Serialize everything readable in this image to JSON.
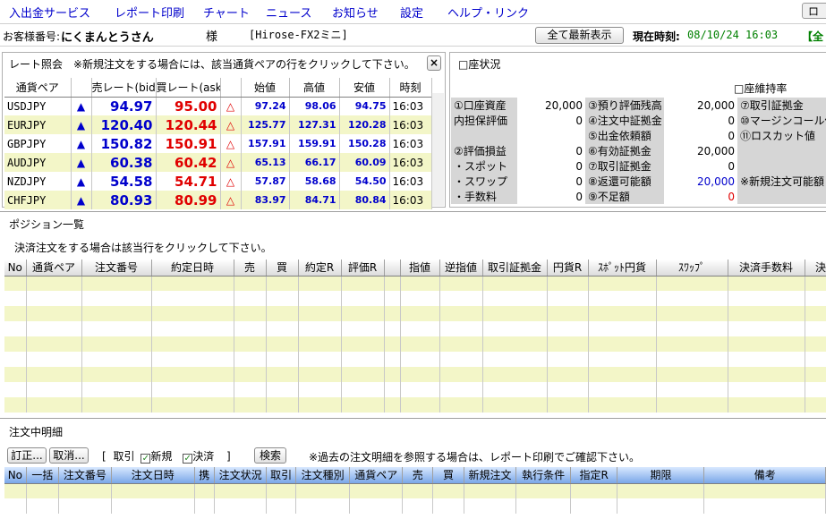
{
  "menu": [
    "入出金サービス",
    "レポート印刷",
    "チャート",
    "ニュース",
    "お知らせ",
    "設定",
    "ヘルプ・リンク"
  ],
  "menu_right": "ロ",
  "account": {
    "customer_label": "お客様番号:",
    "customer_name": "にくまんとうさん",
    "honorific": "様",
    "system": "[Hirose-FX2ミニ]",
    "refresh_button": "全て最新表示",
    "time_label": "現在時刻:",
    "time_value": "08/10/24 16:03",
    "overflow": "【全"
  },
  "rate_panel": {
    "title": "レート照会　※新規注文をする場合には、該当通貨ペアの行をクリックして下さい。",
    "close": "×",
    "headers": [
      "通貨ペア",
      "",
      "売レート(bid)",
      "買レート(ask)",
      "",
      "始値",
      "高値",
      "安値",
      "時刻"
    ],
    "rows": [
      {
        "pair": "USDJPY",
        "bid": "94.97",
        "ask": "95.00",
        "open": "97.24",
        "high": "98.06",
        "low": "94.75",
        "time": "16:03"
      },
      {
        "pair": "EURJPY",
        "bid": "120.40",
        "ask": "120.44",
        "open": "125.77",
        "high": "127.31",
        "low": "120.28",
        "time": "16:03"
      },
      {
        "pair": "GBPJPY",
        "bid": "150.82",
        "ask": "150.91",
        "open": "157.91",
        "high": "159.91",
        "low": "150.28",
        "time": "16:03"
      },
      {
        "pair": "AUDJPY",
        "bid": "60.38",
        "ask": "60.42",
        "open": "65.13",
        "high": "66.17",
        "low": "60.09",
        "time": "16:03"
      },
      {
        "pair": "NZDJPY",
        "bid": "54.58",
        "ask": "54.71",
        "open": "57.87",
        "high": "58.68",
        "low": "54.50",
        "time": "16:03"
      },
      {
        "pair": "CHFJPY",
        "bid": "80.93",
        "ask": "80.99",
        "open": "83.97",
        "high": "84.71",
        "low": "80.84",
        "time": "16:03"
      }
    ],
    "bid_icon": "▲",
    "ask_icon": "△"
  },
  "account_panel": {
    "title": "□座状況",
    "maintenance": "□座維持率",
    "rows": [
      [
        "①口座資産",
        "20,000",
        "③預り評価残高",
        "20,000",
        "⑦取引証拠金"
      ],
      [
        "内担保評価",
        "0",
        "④注文中証拠金",
        "0",
        "⑩マージンコール値"
      ],
      [
        "",
        "",
        "⑤出金依頼額",
        "0",
        "⑪ロスカット値"
      ],
      [
        "②評価損益",
        "0",
        "⑥有効証拠金",
        "20,000",
        ""
      ],
      [
        "・スポット",
        "0",
        "⑦取引証拠金",
        "0",
        ""
      ],
      [
        "・スワップ",
        "0",
        "⑧返還可能額",
        "20,000",
        "※新規注文可能額"
      ],
      [
        "・手数料",
        "0",
        "⑨不足額",
        "0",
        ""
      ]
    ]
  },
  "position_panel": {
    "title": "ポジション一覧",
    "note": "決済注文をする場合は該当行をクリックして下さい。",
    "headers": [
      "No",
      "通貨ペア",
      "注文番号",
      "約定日時",
      "売",
      "買",
      "約定R",
      "評価R",
      "",
      "指値",
      "逆指値",
      "取引証拠金",
      "円貨R",
      "ｽﾎﾟｯﾄ円貨",
      "ｽﾜｯﾌﾟ",
      "決済手数料",
      "決"
    ]
  },
  "order_panel": {
    "title": "注文中明細",
    "modify": "訂正...",
    "cancel": "取消...",
    "filter_open": "[",
    "filter_trade": "取引",
    "filter_new": "新規",
    "filter_settle": "決済",
    "filter_close": "]",
    "search": "検索",
    "note": "※過去の注文明細を参照する場合は、レポート印刷でご確認下さい。",
    "headers": [
      "No",
      "一括",
      "注文番号",
      "注文日時",
      "携",
      "注文状況",
      "取引",
      "注文種別",
      "通貨ペア",
      "売",
      "買",
      "新規注文",
      "執行条件",
      "指定R",
      "期限",
      "備考"
    ]
  },
  "colors": {
    "bid": "#0000cc",
    "ask": "#e00000",
    "row_alt": "#f3f6c8"
  }
}
